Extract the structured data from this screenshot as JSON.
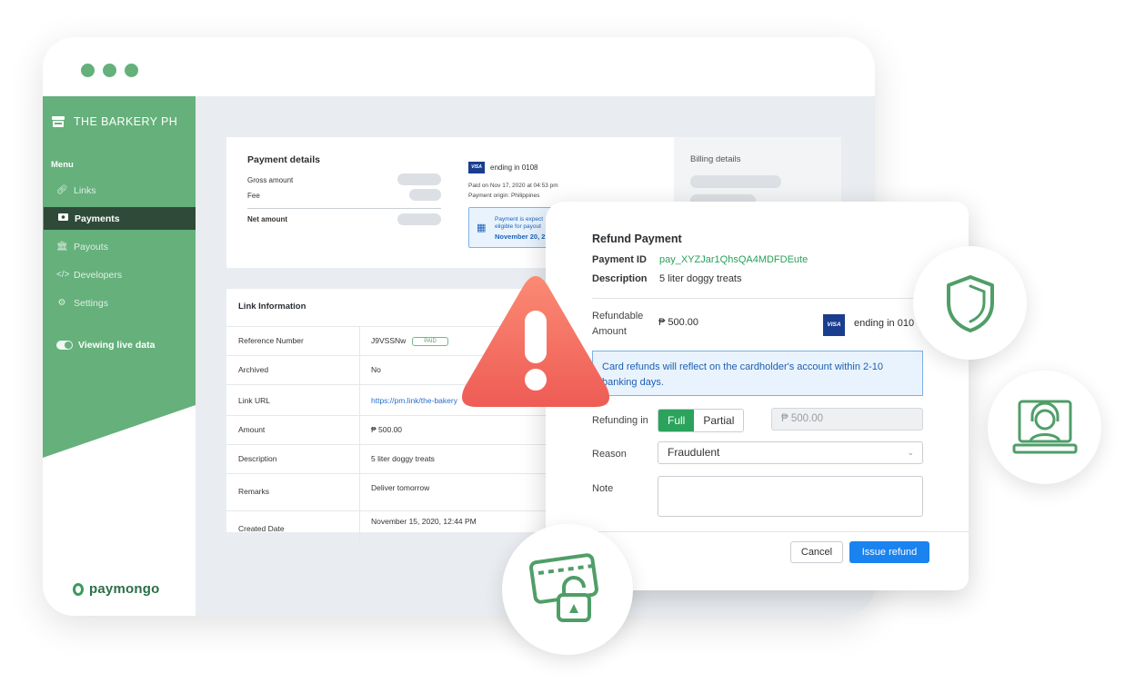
{
  "sidebar": {
    "brand": "THE BARKERY PH",
    "menu_title": "Menu",
    "items": [
      {
        "label": "Links",
        "icon": "link-icon"
      },
      {
        "label": "Payments",
        "icon": "payments-icon"
      },
      {
        "label": "Payouts",
        "icon": "bank-icon"
      },
      {
        "label": "Developers",
        "icon": "code-icon"
      },
      {
        "label": "Settings",
        "icon": "gear-icon"
      }
    ],
    "live_toggle": "Viewing live data",
    "logo": "paymongo"
  },
  "payment_details": {
    "title": "Payment details",
    "gross_label": "Gross amount",
    "fee_label": "Fee",
    "net_label": "Net amount",
    "card_brand": "VISA",
    "card_ending": "ending in 0108",
    "paid_on": "Paid on Nov 17, 2020 at 04:53 pm",
    "origin": "Payment origin: Philippines",
    "notice_line": "Payment is expect eligible for payout",
    "notice_date": "November 20, 2"
  },
  "billing": {
    "title": "Billing details"
  },
  "link_info": {
    "title": "Link Information",
    "rows": [
      {
        "key": "Reference Number",
        "value": "J9VSSNw",
        "badge": "PAID"
      },
      {
        "key": "Archived",
        "value": "No"
      },
      {
        "key": "Link URL",
        "value": "https://pm.link/the-bakery"
      },
      {
        "key": "Amount",
        "value": "₱ 500.00"
      },
      {
        "key": "Description",
        "value": "5 liter doggy treats"
      },
      {
        "key": "Remarks",
        "value": "Deliver tomorrow"
      },
      {
        "key": "Created Date",
        "value": "November 15, 2020, 12:44 PM"
      }
    ]
  },
  "refund": {
    "title": "Refund Payment",
    "payment_id_label": "Payment ID",
    "payment_id": "pay_XYZJar1QhsQA4MDFDEute",
    "description_label": "Description",
    "description": "5 liter doggy treats",
    "refundable_label": "Refundable Amount",
    "refundable_amount": "₱ 500.00",
    "card_brand": "VISA",
    "card_ending": "ending in 010",
    "notice": "Card refunds will reflect on the cardholder's account within 2-10 banking days.",
    "refunding_in_label": "Refunding in",
    "full_label": "Full",
    "partial_label": "Partial",
    "amount_value": "₱  500.00",
    "reason_label": "Reason",
    "reason_value": "Fraudulent",
    "note_label": "Note",
    "cancel_label": "Cancel",
    "issue_label": "Issue refund"
  },
  "colors": {
    "brand_green": "#65b07b",
    "active_nav": "#2f4a39",
    "primary_blue": "#1a83ef",
    "warning_red": "#f36b5f"
  }
}
